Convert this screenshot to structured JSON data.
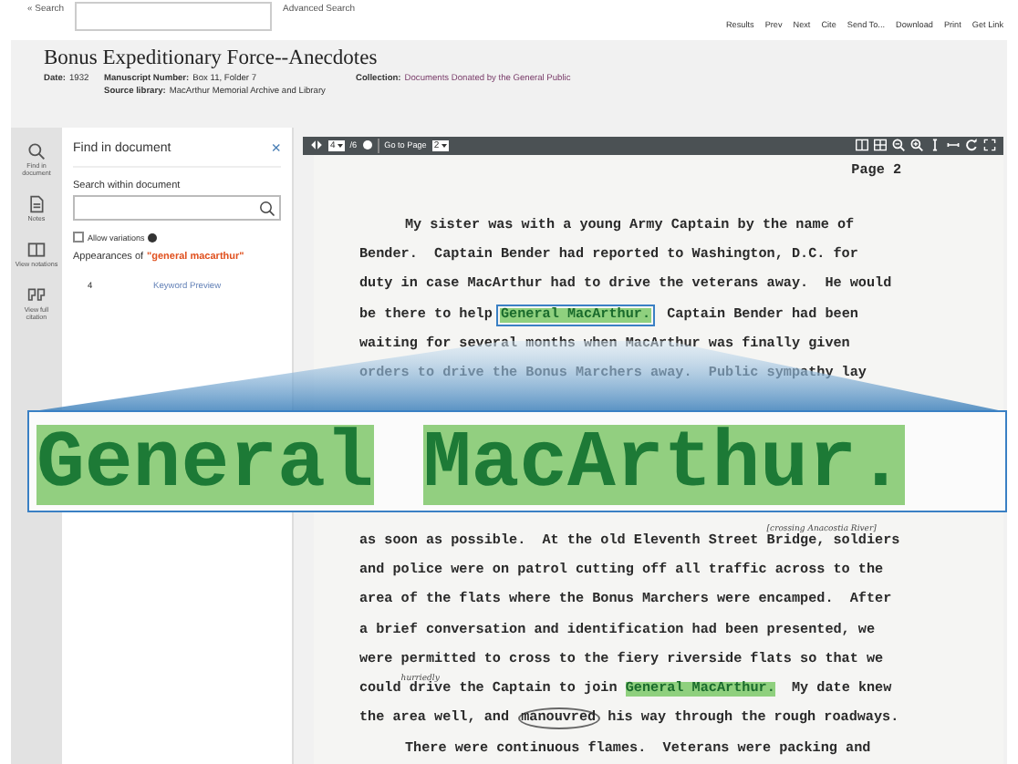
{
  "top_bar": {
    "back_link": "« Search",
    "advanced_link": "Advanced Search",
    "actions": [
      "Results",
      "Prev",
      "Next",
      "Cite",
      "Send To...",
      "Download",
      "Print",
      "Get Link"
    ]
  },
  "header": {
    "title": "Bonus Expeditionary Force--Anecdotes",
    "meta": [
      {
        "label": "Date:",
        "value": "1932",
        "kind": "text"
      },
      {
        "label": "Manuscript Number:",
        "value": "Box 11, Folder 7",
        "kind": "text"
      },
      {
        "label": "Collection:",
        "value": "Documents Donated by the General Public",
        "kind": "link"
      },
      {
        "label": "Source library:",
        "value": "MacArthur Memorial Archive and Library",
        "kind": "text"
      }
    ]
  },
  "rail": [
    {
      "kind": "search",
      "label": "Find in document"
    },
    {
      "kind": "notes",
      "label": "Notes"
    },
    {
      "kind": "view",
      "label": "View notations"
    },
    {
      "kind": "citation",
      "label": "View full citation"
    }
  ],
  "find_panel": {
    "title": "Find in document",
    "close": "×",
    "search_label": "Search within document",
    "variations": {
      "label": "Allow variations",
      "checked": false
    },
    "appearances_label": "Appearances of",
    "query": "\"general macarthur\"",
    "results": [
      {
        "page": "4",
        "label": "Keyword Preview"
      }
    ]
  },
  "viewer": {
    "page_select": "4",
    "page_count": "/6",
    "goto_label": "Go to Page",
    "goto_select": "2"
  },
  "document": {
    "page_label": "Page 2",
    "lines_above": [
      {
        "indent": true,
        "segments": [
          {
            "kind": "plain",
            "text": "My sister was with a young Army Captain by the name of"
          }
        ]
      },
      {
        "indent": false,
        "segments": [
          {
            "kind": "plain",
            "text": "Bender.  Captain Bender had reported to Washington, D.C. for"
          }
        ]
      },
      {
        "indent": false,
        "segments": [
          {
            "kind": "plain",
            "text": "duty in case MacArthur had to drive the veterans away.  He would"
          }
        ]
      },
      {
        "indent": false,
        "segments": [
          {
            "kind": "plain",
            "text": "be there to help "
          },
          {
            "kind": "highlight-boxed",
            "text": "General MacArthur."
          },
          {
            "kind": "plain",
            "text": "  Captain Bender had been"
          }
        ]
      },
      {
        "indent": false,
        "segments": [
          {
            "kind": "plain",
            "text": "waiting for several months when MacArthur was finally given"
          }
        ]
      },
      {
        "indent": false,
        "segments": [
          {
            "kind": "plain",
            "text": "orders to drive the Bonus Marchers away.  Public sympathy lay"
          }
        ]
      }
    ],
    "lines_below": [
      {
        "indent": false,
        "segments": [
          {
            "kind": "plain",
            "text": "as soon as possible.  At the old Eleventh Street "
          },
          {
            "kind": "plain",
            "text": "Bridge, soldiers",
            "note": "[crossing Anacostia River]"
          }
        ]
      },
      {
        "indent": false,
        "segments": [
          {
            "kind": "plain",
            "text": "and police were on patrol cutting off all traffic across to the"
          }
        ]
      },
      {
        "indent": false,
        "segments": [
          {
            "kind": "plain",
            "text": "area of the flats where the Bonus Marchers were encamped.  After"
          }
        ]
      },
      {
        "indent": false,
        "segments": [
          {
            "kind": "plain",
            "text": "a brief conversation and identification had been presented, we"
          }
        ]
      },
      {
        "indent": false,
        "segments": [
          {
            "kind": "plain",
            "text": "were permitted to cross to the fiery riverside flats so that we"
          }
        ]
      },
      {
        "indent": false,
        "segments": [
          {
            "kind": "plain",
            "text": "could"
          },
          {
            "kind": "plain",
            "text": " drive the Captain to join ",
            "note": "hurriedly"
          },
          {
            "kind": "highlight",
            "text": "General MacArthur."
          },
          {
            "kind": "plain",
            "text": "  My date knew"
          }
        ]
      },
      {
        "indent": false,
        "segments": [
          {
            "kind": "plain",
            "text": "the area well, and "
          },
          {
            "kind": "circled",
            "text": "manouvred"
          },
          {
            "kind": "plain",
            "text": " his way through the rough roadways."
          }
        ]
      },
      {
        "indent": true,
        "segments": [
          {
            "kind": "plain",
            "text": "There were continuous flames.  Veterans were packing and"
          }
        ]
      }
    ]
  },
  "magnifier": {
    "words": [
      "General",
      "MacArthur."
    ]
  }
}
